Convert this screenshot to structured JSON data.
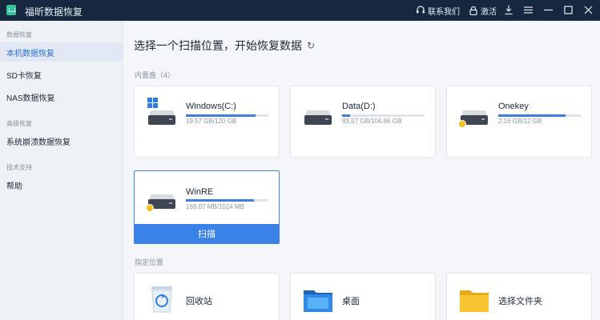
{
  "titlebar": {
    "app_title": "福昕数据恢复",
    "contact_label": "联系我们",
    "activate_label": "激活",
    "colors": {
      "background": "#162840"
    }
  },
  "sidebar": {
    "sections": [
      {
        "title": "数据恢复",
        "items": [
          {
            "label": "本机数据恢复",
            "active": true
          },
          {
            "label": "SD卡恢复"
          },
          {
            "label": "NAS数据恢复"
          }
        ]
      },
      {
        "title": "高级恢复",
        "items": [
          {
            "label": "系统崩溃数据恢复"
          }
        ]
      },
      {
        "title": "技术支持",
        "items": [
          {
            "label": "帮助"
          }
        ]
      }
    ]
  },
  "main": {
    "heading": "选择一个扫描位置，开始恢复数据",
    "refresh_icon": "↻",
    "internal_label": "内置盘（4）",
    "disks": [
      {
        "name": "Windows(C:)",
        "size": "19.57 GB/120 GB",
        "used_fraction": 0.84,
        "icon": "system-drive-icon"
      },
      {
        "name": "Data(D:)",
        "size": "93.57 GB/104.86 GB",
        "used_fraction": 0.1,
        "icon": "drive-icon"
      },
      {
        "name": "Onekey",
        "size": "2.16 GB/12 GB",
        "used_fraction": 0.82,
        "icon": "drive-badge-icon"
      },
      {
        "name": "WinRE",
        "size": "169.07 MB/1024 MB",
        "used_fraction": 0.83,
        "icon": "drive-badge-icon"
      }
    ],
    "scan_label": "扫描",
    "locations_label": "指定位置",
    "locations": [
      {
        "name": "回收站",
        "icon": "recycle-bin-icon"
      },
      {
        "name": "桌面",
        "icon": "desktop-folder-icon"
      },
      {
        "name": "选择文件夹",
        "icon": "folder-icon"
      }
    ],
    "colors": {
      "accent": "#3b82e8",
      "bar": "#3b7fe0"
    }
  }
}
